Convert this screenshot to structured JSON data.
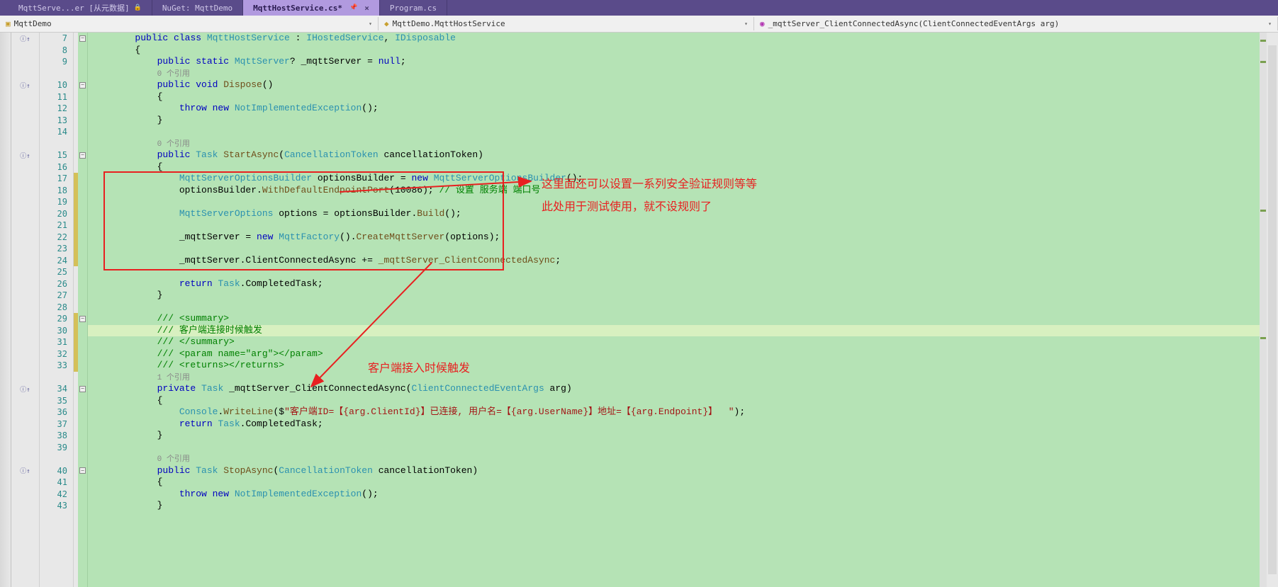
{
  "tabs": [
    {
      "label": "MqttServe...er [从元数据]",
      "locked": true,
      "active": false
    },
    {
      "label": "NuGet: MqttDemo",
      "active": false
    },
    {
      "label": "MqttHostService.cs*",
      "active": true,
      "pinned": true
    },
    {
      "label": "Program.cs",
      "active": false
    }
  ],
  "breadcrumb": {
    "namespace": "MqttDemo",
    "class": "MqttDemo.MqttHostService",
    "member": "_mqttServer_ClientConnectedAsync(ClientConnectedEventArgs arg)"
  },
  "annotations": {
    "box_note_line1": "这里面还可以设置一系列安全验证规则等等",
    "box_note_line2": "此处用于测试使用，就不设规则了",
    "bottom_note": "客户端接入时候触发"
  },
  "ref_hints": {
    "zero": "0 个引用",
    "one": "1 个引用"
  },
  "code": {
    "l7": {
      "indent": 2,
      "tokens": [
        [
          "kw",
          "public"
        ],
        [
          "",
          ""
        ],
        [
          "kw",
          " class "
        ],
        [
          "type",
          "MqttHostService"
        ],
        [
          "",
          " : "
        ],
        [
          "type",
          "IHostedService"
        ],
        [
          "",
          ", "
        ],
        [
          "type",
          "IDisposable"
        ]
      ]
    },
    "l8": {
      "indent": 2,
      "tokens": [
        [
          "punc",
          "{"
        ]
      ]
    },
    "l9": {
      "indent": 3,
      "tokens": [
        [
          "kw",
          "public static "
        ],
        [
          "type",
          "MqttServer"
        ],
        [
          "",
          "? _mqttServer = "
        ],
        [
          "kw",
          "null"
        ],
        [
          "",
          ";"
        ]
      ]
    },
    "l9b": {
      "indent": 3,
      "tokens": [
        [
          "ref-hint",
          "0 个引用"
        ]
      ]
    },
    "l10": {
      "indent": 3,
      "tokens": [
        [
          "kw",
          "public void "
        ],
        [
          "method",
          "Dispose"
        ],
        [
          "",
          "()"
        ]
      ]
    },
    "l11": {
      "indent": 3,
      "tokens": [
        [
          "punc",
          "{"
        ]
      ]
    },
    "l12": {
      "indent": 4,
      "tokens": [
        [
          "kw",
          "throw new "
        ],
        [
          "type",
          "NotImplementedException"
        ],
        [
          "",
          "();"
        ]
      ]
    },
    "l13": {
      "indent": 3,
      "tokens": [
        [
          "punc",
          "}"
        ]
      ]
    },
    "l14": {
      "indent": 0,
      "tokens": [
        [
          "",
          ""
        ]
      ]
    },
    "l14b": {
      "indent": 3,
      "tokens": [
        [
          "ref-hint",
          "0 个引用"
        ]
      ]
    },
    "l15": {
      "indent": 3,
      "tokens": [
        [
          "kw",
          "public "
        ],
        [
          "type",
          "Task "
        ],
        [
          "method",
          "StartAsync"
        ],
        [
          "",
          "("
        ],
        [
          "type",
          "CancellationToken"
        ],
        [
          "",
          " cancellationToken)"
        ]
      ]
    },
    "l16": {
      "indent": 3,
      "tokens": [
        [
          "punc",
          "{"
        ]
      ]
    },
    "l17": {
      "indent": 4,
      "tokens": [
        [
          "type",
          "MqttServerOptionsBuilder"
        ],
        [
          "",
          " optionsBuilder = "
        ],
        [
          "kw",
          "new "
        ],
        [
          "type",
          "MqttServerOptionsBuilder"
        ],
        [
          "",
          "();"
        ]
      ]
    },
    "l18": {
      "indent": 4,
      "tokens": [
        [
          "",
          "optionsBuilder."
        ],
        [
          "method",
          "WithDefaultEndpointPort"
        ],
        [
          "",
          "(10086); "
        ],
        [
          "comment",
          "// 设置 服务端 端口号"
        ]
      ]
    },
    "l19": {
      "indent": 0,
      "tokens": [
        [
          "",
          ""
        ]
      ]
    },
    "l20": {
      "indent": 4,
      "tokens": [
        [
          "type",
          "MqttServerOptions"
        ],
        [
          "",
          " options = optionsBuilder."
        ],
        [
          "method",
          "Build"
        ],
        [
          "",
          "();"
        ]
      ]
    },
    "l21": {
      "indent": 0,
      "tokens": [
        [
          "",
          ""
        ]
      ]
    },
    "l22": {
      "indent": 4,
      "tokens": [
        [
          "",
          "_mqttServer = "
        ],
        [
          "kw",
          "new "
        ],
        [
          "type",
          "MqttFactory"
        ],
        [
          "",
          "()."
        ],
        [
          "method",
          "CreateMqttServer"
        ],
        [
          "",
          "(options);"
        ]
      ]
    },
    "l23": {
      "indent": 0,
      "tokens": [
        [
          "",
          ""
        ]
      ]
    },
    "l24": {
      "indent": 4,
      "tokens": [
        [
          "",
          "_mqttServer.ClientConnectedAsync += "
        ],
        [
          "method",
          "_mqttServer_ClientConnectedAsync"
        ],
        [
          "",
          ";"
        ]
      ]
    },
    "l25": {
      "indent": 0,
      "tokens": [
        [
          "",
          ""
        ]
      ]
    },
    "l26": {
      "indent": 4,
      "tokens": [
        [
          "kw",
          "return "
        ],
        [
          "type",
          "Task"
        ],
        [
          "",
          ".CompletedTask;"
        ]
      ]
    },
    "l27": {
      "indent": 3,
      "tokens": [
        [
          "punc",
          "}"
        ]
      ]
    },
    "l28": {
      "indent": 0,
      "tokens": [
        [
          "",
          ""
        ]
      ]
    },
    "l29": {
      "indent": 3,
      "tokens": [
        [
          "comment",
          "/// <summary>"
        ]
      ]
    },
    "l30": {
      "indent": 3,
      "tokens": [
        [
          "comment",
          "/// 客户端连接时候触发"
        ]
      ]
    },
    "l31": {
      "indent": 3,
      "tokens": [
        [
          "comment",
          "/// </summary>"
        ]
      ]
    },
    "l32": {
      "indent": 3,
      "tokens": [
        [
          "comment",
          "/// <param name=\"arg\"></param>"
        ]
      ]
    },
    "l33": {
      "indent": 3,
      "tokens": [
        [
          "comment",
          "/// <returns></returns>"
        ]
      ]
    },
    "l33b": {
      "indent": 3,
      "tokens": [
        [
          "ref-hint",
          "1 个引用"
        ]
      ]
    },
    "l34": {
      "indent": 3,
      "tokens": [
        [
          "kw",
          "private "
        ],
        [
          "type",
          "Task "
        ],
        [
          "",
          "_mqttServer_ClientConnectedAsync("
        ],
        [
          "type",
          "ClientConnectedEventArgs"
        ],
        [
          "",
          " arg)"
        ]
      ]
    },
    "l35": {
      "indent": 3,
      "tokens": [
        [
          "punc",
          "{"
        ]
      ]
    },
    "l36": {
      "indent": 4,
      "tokens": [
        [
          "type",
          "Console"
        ],
        [
          "",
          "."
        ],
        [
          "method",
          "WriteLine"
        ],
        [
          "",
          "($"
        ],
        [
          "str",
          "\"客户端ID=【{arg.ClientId}】已连接, 用户名=【{arg.UserName}】地址=【{arg.Endpoint}】  \""
        ],
        [
          "",
          ");"
        ]
      ]
    },
    "l37": {
      "indent": 4,
      "tokens": [
        [
          "kw",
          "return "
        ],
        [
          "type",
          "Task"
        ],
        [
          "",
          ".CompletedTask;"
        ]
      ]
    },
    "l38": {
      "indent": 3,
      "tokens": [
        [
          "punc",
          "}"
        ]
      ]
    },
    "l39": {
      "indent": 0,
      "tokens": [
        [
          "",
          ""
        ]
      ]
    },
    "l39b": {
      "indent": 3,
      "tokens": [
        [
          "ref-hint",
          "0 个引用"
        ]
      ]
    },
    "l40": {
      "indent": 3,
      "tokens": [
        [
          "kw",
          "public "
        ],
        [
          "type",
          "Task "
        ],
        [
          "method",
          "StopAsync"
        ],
        [
          "",
          "("
        ],
        [
          "type",
          "CancellationToken"
        ],
        [
          "",
          " cancellationToken)"
        ]
      ]
    },
    "l41": {
      "indent": 3,
      "tokens": [
        [
          "punc",
          "{"
        ]
      ]
    },
    "l42": {
      "indent": 4,
      "tokens": [
        [
          "kw",
          "throw new "
        ],
        [
          "type",
          "NotImplementedException"
        ],
        [
          "",
          "();"
        ]
      ]
    },
    "l43": {
      "indent": 3,
      "tokens": [
        [
          "punc",
          "}"
        ]
      ]
    }
  },
  "line_order": [
    {
      "n": "7",
      "k": "l7",
      "g": "i",
      "f": "-"
    },
    {
      "n": "8",
      "k": "l8",
      "f": ""
    },
    {
      "n": "9",
      "k": "l9",
      "f": ""
    },
    {
      "n": "",
      "k": "l9b",
      "f": ""
    },
    {
      "n": "10",
      "k": "l10",
      "g": "i",
      "f": "-"
    },
    {
      "n": "11",
      "k": "l11",
      "f": ""
    },
    {
      "n": "12",
      "k": "l12",
      "f": ""
    },
    {
      "n": "13",
      "k": "l13",
      "f": ""
    },
    {
      "n": "14",
      "k": "l14",
      "f": ""
    },
    {
      "n": "",
      "k": "l14b",
      "f": ""
    },
    {
      "n": "15",
      "k": "l15",
      "g": "i",
      "f": "-"
    },
    {
      "n": "16",
      "k": "l16",
      "f": ""
    },
    {
      "n": "17",
      "k": "l17",
      "f": "",
      "c": true
    },
    {
      "n": "18",
      "k": "l18",
      "f": "",
      "c": true
    },
    {
      "n": "19",
      "k": "l19",
      "f": "",
      "c": true
    },
    {
      "n": "20",
      "k": "l20",
      "f": "",
      "c": true
    },
    {
      "n": "21",
      "k": "l21",
      "f": "",
      "c": true
    },
    {
      "n": "22",
      "k": "l22",
      "f": "",
      "c": true
    },
    {
      "n": "23",
      "k": "l23",
      "f": "",
      "c": true
    },
    {
      "n": "24",
      "k": "l24",
      "f": "",
      "c": true
    },
    {
      "n": "25",
      "k": "l25",
      "f": ""
    },
    {
      "n": "26",
      "k": "l26",
      "f": ""
    },
    {
      "n": "27",
      "k": "l27",
      "f": ""
    },
    {
      "n": "28",
      "k": "l28",
      "f": ""
    },
    {
      "n": "29",
      "k": "l29",
      "f": "-",
      "c": true
    },
    {
      "n": "30",
      "k": "l30",
      "f": "",
      "hl": true,
      "c": true
    },
    {
      "n": "31",
      "k": "l31",
      "f": "",
      "c": true
    },
    {
      "n": "32",
      "k": "l32",
      "f": "",
      "c": true
    },
    {
      "n": "33",
      "k": "l33",
      "f": "",
      "c": true
    },
    {
      "n": "",
      "k": "l33b",
      "f": ""
    },
    {
      "n": "34",
      "k": "l34",
      "g": "i",
      "f": "-"
    },
    {
      "n": "35",
      "k": "l35",
      "f": ""
    },
    {
      "n": "36",
      "k": "l36",
      "f": ""
    },
    {
      "n": "37",
      "k": "l37",
      "f": ""
    },
    {
      "n": "38",
      "k": "l38",
      "f": ""
    },
    {
      "n": "39",
      "k": "l39",
      "f": ""
    },
    {
      "n": "",
      "k": "l39b",
      "f": ""
    },
    {
      "n": "40",
      "k": "l40",
      "g": "i",
      "f": "-"
    },
    {
      "n": "41",
      "k": "l41",
      "f": ""
    },
    {
      "n": "42",
      "k": "l42",
      "f": ""
    },
    {
      "n": "43",
      "k": "l43",
      "f": ""
    }
  ]
}
